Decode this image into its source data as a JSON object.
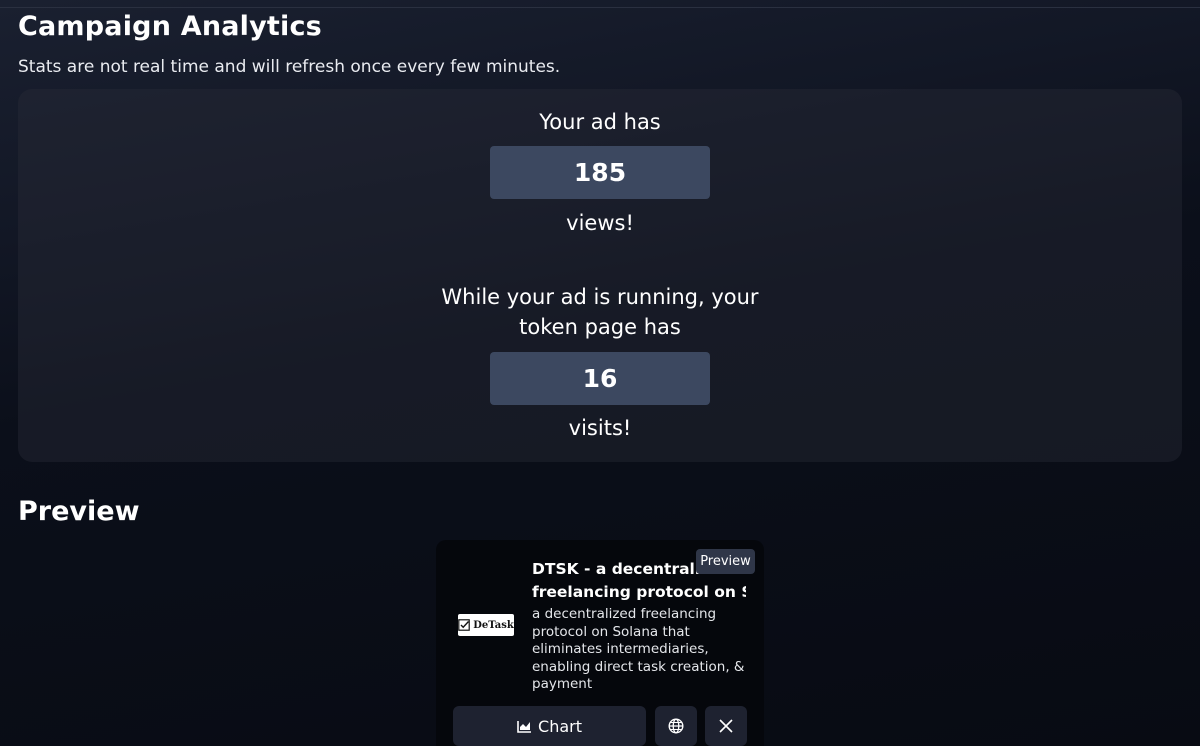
{
  "analytics": {
    "title": "Campaign Analytics",
    "subtitle": "Stats are not real time and will refresh once every few minutes.",
    "views_prefix": "Your ad has",
    "views_count": "185",
    "views_suffix": "views!",
    "visits_prefix_line1": "While your ad is running, your",
    "visits_prefix_line2": "token page has",
    "visits_count": "16",
    "visits_suffix": "visits!"
  },
  "preview": {
    "title": "Preview",
    "badge": "Preview",
    "ad": {
      "logo_text": "DeTask",
      "title_line1": "DTSK - a decentralized",
      "title_line2": "freelancing protocol on Sol",
      "description": "a decentralized freelancing protocol on Solana that eliminates intermediaries, enabling direct task creation, & payment",
      "chart_label": "Chart",
      "icons": [
        "chart-icon",
        "globe-icon",
        "x-icon"
      ]
    }
  },
  "colors": {
    "background": "#0b0f19",
    "card": "#20242f",
    "stat_box": "#3c4860",
    "ad_card": "#05070c",
    "button": "#1e2230"
  }
}
